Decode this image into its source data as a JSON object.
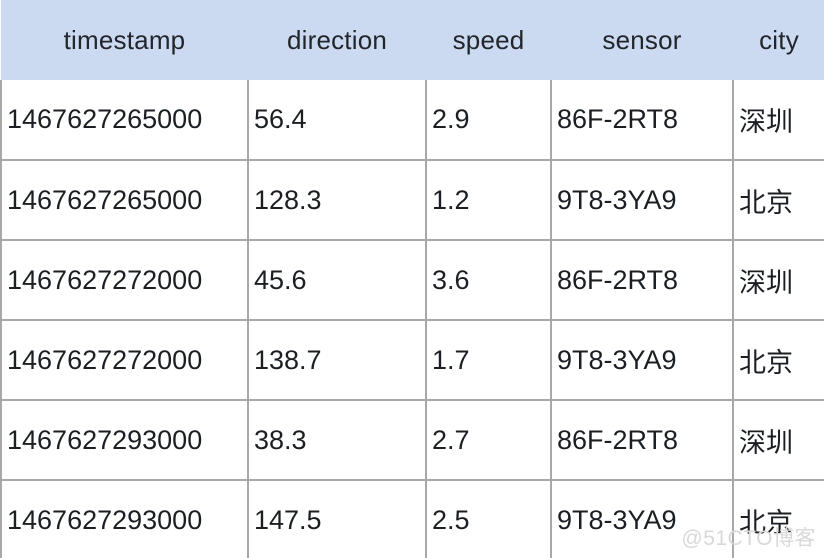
{
  "table": {
    "columns": [
      {
        "key": "timestamp",
        "label": "timestamp"
      },
      {
        "key": "direction",
        "label": "direction"
      },
      {
        "key": "speed",
        "label": "speed"
      },
      {
        "key": "sensor",
        "label": "sensor"
      },
      {
        "key": "city",
        "label": "city"
      }
    ],
    "rows": [
      {
        "timestamp": "1467627265000",
        "direction": "56.4",
        "speed": "2.9",
        "sensor": "86F-2RT8",
        "city": "深圳"
      },
      {
        "timestamp": "1467627265000",
        "direction": "128.3",
        "speed": "1.2",
        "sensor": "9T8-3YA9",
        "city": "北京"
      },
      {
        "timestamp": "1467627272000",
        "direction": "45.6",
        "speed": "3.6",
        "sensor": "86F-2RT8",
        "city": "深圳"
      },
      {
        "timestamp": "1467627272000",
        "direction": "138.7",
        "speed": "1.7",
        "sensor": "9T8-3YA9",
        "city": "北京"
      },
      {
        "timestamp": "1467627293000",
        "direction": "38.3",
        "speed": "2.7",
        "sensor": "86F-2RT8",
        "city": "深圳"
      },
      {
        "timestamp": "1467627293000",
        "direction": "147.5",
        "speed": "2.5",
        "sensor": "9T8-3YA9",
        "city": "北京"
      }
    ]
  },
  "watermark": {
    "text": "@51CTO博客"
  },
  "colors": {
    "header_background": "#cbdaf0",
    "cell_background": "#ffffff",
    "border": "#a8a8a8",
    "text": "#1b1f24",
    "watermark_text": "#d8d8d8"
  }
}
